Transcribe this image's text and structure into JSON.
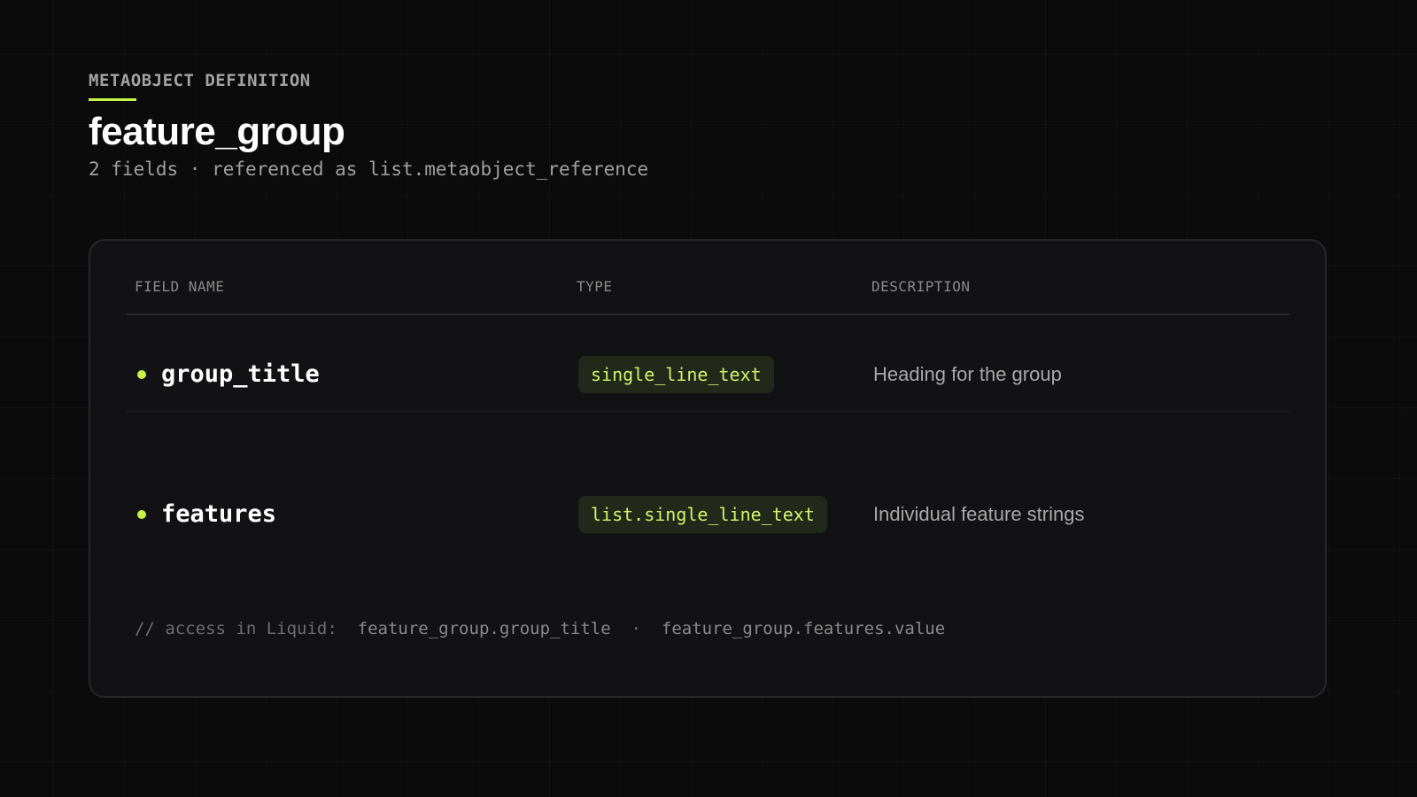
{
  "header": {
    "eyebrow": "METAOBJECT DEFINITION",
    "title": "feature_group",
    "subtitle": "2 fields · referenced as list.metaobject_reference"
  },
  "table": {
    "columns": [
      "FIELD NAME",
      "TYPE",
      "DESCRIPTION"
    ],
    "rows": [
      {
        "name": "group_title",
        "type": "single_line_text",
        "description": "Heading for the group"
      },
      {
        "name": "features",
        "type": "list.single_line_text",
        "description": "Individual feature strings"
      }
    ]
  },
  "footer": {
    "prefix": "// access in Liquid:",
    "snippet_1": "feature_group.group_title",
    "separator": "·",
    "snippet_2": "feature_group.features.value"
  },
  "colors": {
    "accent": "#c6f24a",
    "background": "#0b0b0c",
    "card": "#121214",
    "pill_bg": "#22281a",
    "pill_text": "#d4f46a"
  }
}
